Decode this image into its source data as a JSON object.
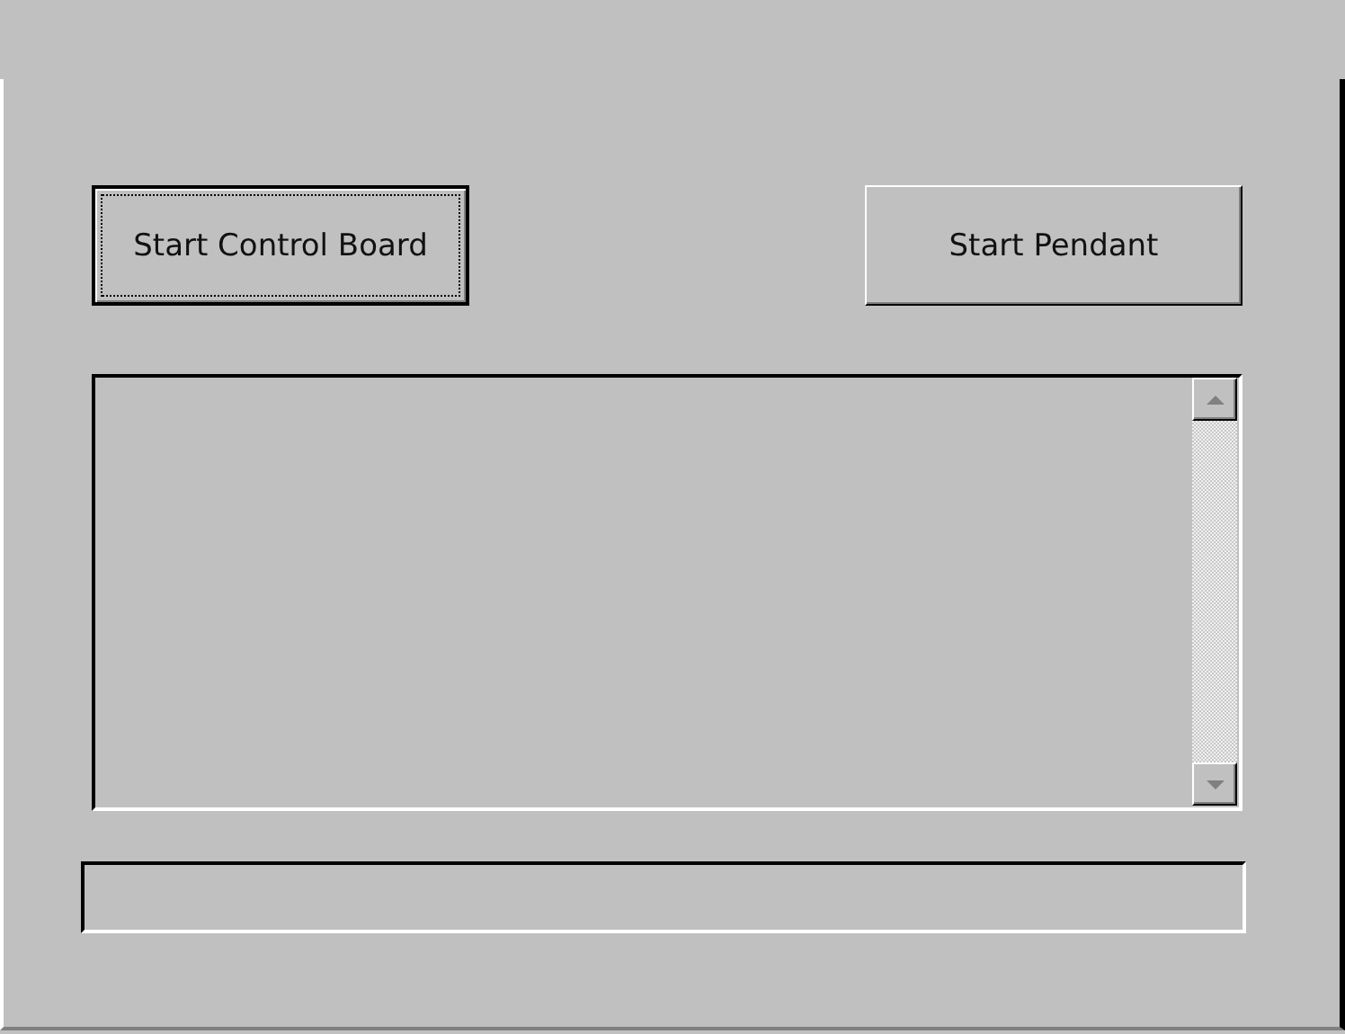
{
  "buttons": [
    {
      "label": "Start Control Board",
      "focused": true
    },
    {
      "label": "Start Pendant",
      "focused": false
    }
  ]
}
